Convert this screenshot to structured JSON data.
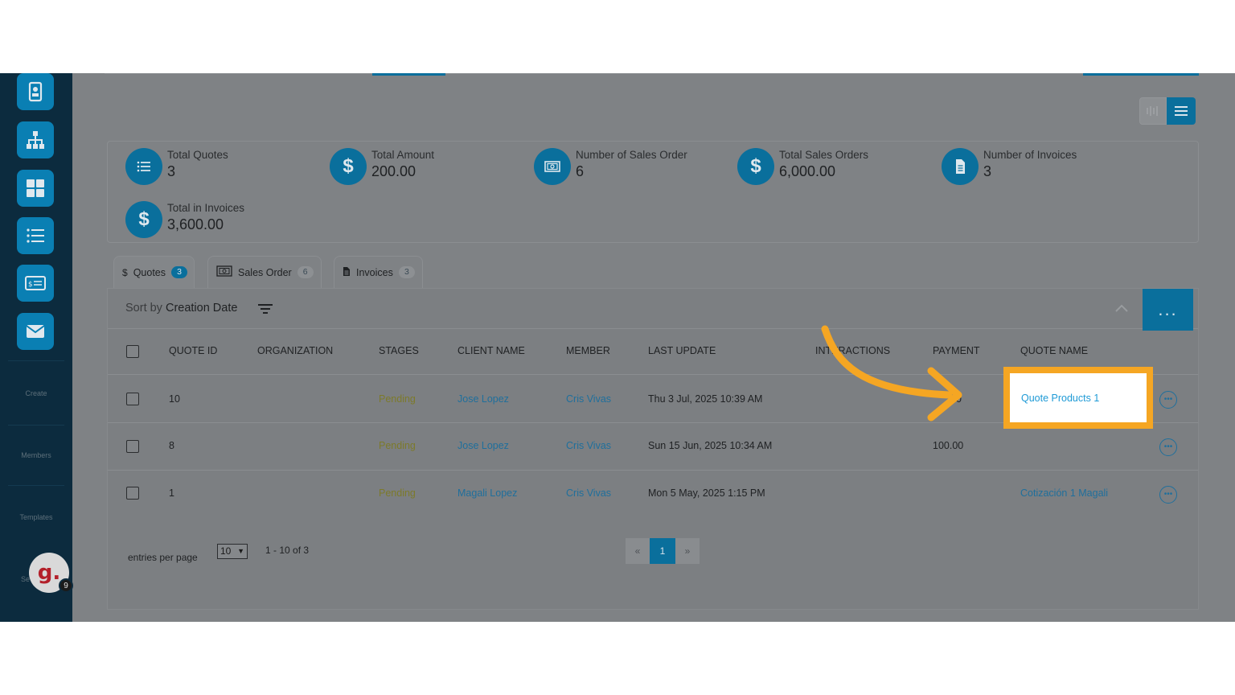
{
  "sidebar": {
    "labels": {
      "create": "Create",
      "members": "Members",
      "templates": "Templates",
      "peek": "Se"
    },
    "avatar_letter": "g.",
    "avatar_badge": "9"
  },
  "summary": [
    {
      "label": "Total Quotes",
      "value": "3",
      "icon": "list-icon"
    },
    {
      "label": "Total Amount",
      "value": "200.00",
      "icon": "dollar-icon"
    },
    {
      "label": "Number of Sales Order",
      "value": "6",
      "icon": "sales-order-icon"
    },
    {
      "label": "Total Sales Orders",
      "value": "6,000.00",
      "icon": "dollar-icon"
    },
    {
      "label": "Number of Invoices",
      "value": "3",
      "icon": "document-icon"
    },
    {
      "label": "Total in Invoices",
      "value": "3,600.00",
      "icon": "dollar-icon"
    }
  ],
  "tabs": [
    {
      "icon": "$",
      "label": "Quotes",
      "count": "3"
    },
    {
      "icon": "sales-order-icon",
      "label": "Sales Order",
      "count": "6"
    },
    {
      "icon": "document-icon",
      "label": "Invoices",
      "count": "3"
    }
  ],
  "sort": {
    "prefix": "Sort by",
    "field": "Creation Date"
  },
  "more_label": "...",
  "table": {
    "headers": [
      "QUOTE ID",
      "ORGANIZATION",
      "STAGES",
      "CLIENT NAME",
      "MEMBER",
      "LAST UPDATE",
      "INTERACTIONS",
      "PAYMENT",
      "QUOTE NAME"
    ],
    "rows": [
      {
        "id": "10",
        "organization": "",
        "stage": "Pending",
        "client": "Jose Lopez",
        "member": "Cris Vivas",
        "updated": "Thu 3 Jul, 2025 10:39 AM",
        "interactions": "",
        "payment": "0",
        "quote_name": "Quote Products 1"
      },
      {
        "id": "8",
        "organization": "",
        "stage": "Pending",
        "client": "Jose Lopez",
        "member": "Cris Vivas",
        "updated": "Sun 15 Jun, 2025 10:34 AM",
        "interactions": "",
        "payment": "100.00",
        "quote_name": ""
      },
      {
        "id": "1",
        "organization": "",
        "stage": "Pending",
        "client": "Magali Lopez",
        "member": "Cris Vivas",
        "updated": "Mon 5 May, 2025 1:15 PM",
        "interactions": "",
        "payment": "",
        "quote_name": "Cotización 1 Magali"
      }
    ]
  },
  "footer": {
    "entries_label": "entries per page",
    "entries_value": "10",
    "range": "1 - 10 of 3",
    "pager": {
      "prev": "«",
      "current": "1",
      "next": "»"
    }
  },
  "colors": {
    "accent": "#0a6f9c",
    "highlight": "#f5a623",
    "sidebar": "#0c2b3e"
  }
}
